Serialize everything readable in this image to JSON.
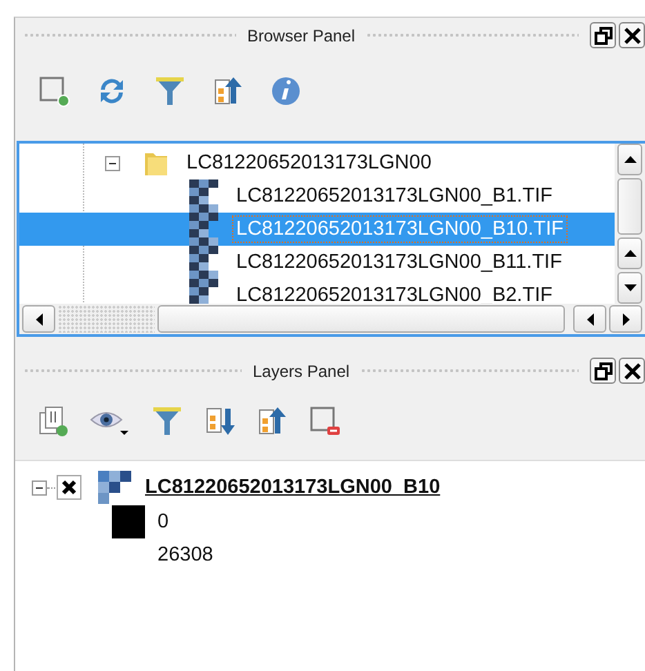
{
  "browser_panel": {
    "title": "Browser Panel",
    "tree": [
      {
        "label": "LC81220652013173LGN00",
        "expanded": true,
        "children": [
          {
            "label": "LC81220652013173LGN00_B1.TIF",
            "selected": false
          },
          {
            "label": "LC81220652013173LGN00_B10.TIF",
            "selected": true
          },
          {
            "label": "LC81220652013173LGN00_B11.TIF",
            "selected": false
          },
          {
            "label": "LC81220652013173LGN00_B2.TIF",
            "selected": false
          }
        ]
      }
    ]
  },
  "layers_panel": {
    "title": "Layers Panel",
    "layers": [
      {
        "name": "LC81220652013173LGN00_B10",
        "checked": true,
        "expanded": true,
        "legend": [
          {
            "label": "0",
            "color": "#000000"
          },
          {
            "label": "26308"
          }
        ]
      }
    ]
  }
}
